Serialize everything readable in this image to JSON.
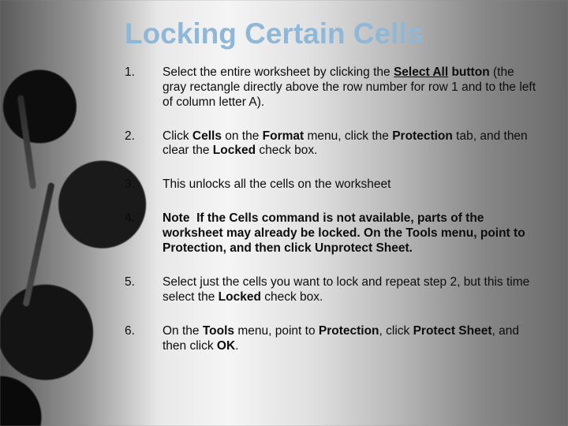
{
  "title": "Locking Certain Cells",
  "steps": {
    "s1": {
      "num": "1.",
      "html": "Select the entire worksheet by clicking the <b><u>Select All</u> button</b> (the gray rectangle directly above the row number for row 1 and to the left of column letter A)."
    },
    "s2": {
      "num": "2.",
      "html": "Click <b>Cells</b> on the <b>Format</b> menu, click the <b>Protection</b> tab, and then clear the <b>Locked</b> check box."
    },
    "s3": {
      "num": "3.",
      "html": "This unlocks all the cells on the worksheet"
    },
    "s4": {
      "num": "4.",
      "html": "<b>Note</b>  If the <b>Cells</b> command is not available, parts of the worksheet may already be locked. On the <b>Tools</b> menu, point to <b>Protection</b>, and then click <b>Unprotect Sheet</b>."
    },
    "s5": {
      "num": "5.",
      "html": "Select just the cells you want to lock and repeat step 2, but this time select the <b>Locked</b> check box."
    },
    "s6": {
      "num": "6.",
      "html": "On the <b>Tools</b> menu, point to <b>Protection</b>, click <b>Protect Sheet</b>, and then click <b>OK</b>."
    }
  }
}
